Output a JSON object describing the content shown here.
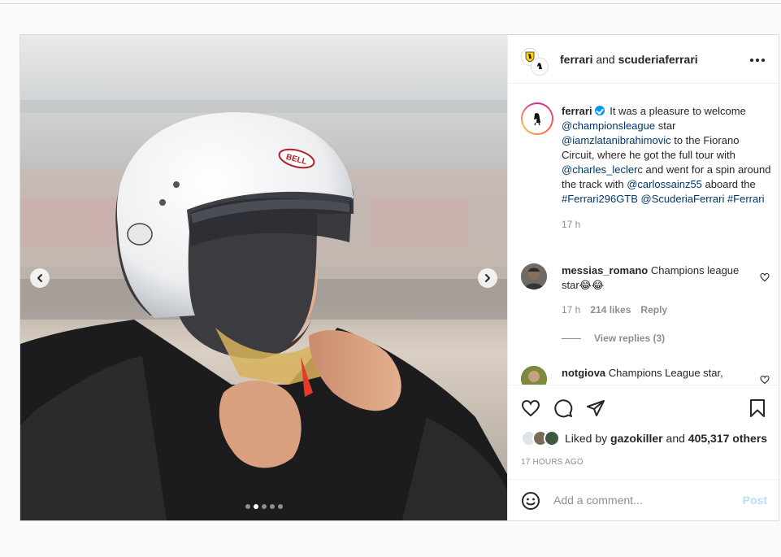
{
  "header": {
    "account1": "ferrari",
    "joiner": "and",
    "account2": "scuderiaferrari",
    "more_icon": "more-horizontal-icon"
  },
  "caption": {
    "username": "ferrari",
    "text_1": "It was a pleasure to welcome",
    "mention_1": "@championsleague",
    "text_2": "star",
    "mention_2": "@iamzlatanibrahimovic",
    "text_3": "to the Fiorano Circuit, where he got the full tour with",
    "mention_3": "@charles_leclerc",
    "text_4": "and went for a spin around the track with",
    "mention_4": "@carlossainz55",
    "text_5": "aboard the",
    "hashtag_1": "#Ferrari296GTB",
    "mention_5": "@ScuderiaFerrari",
    "hashtag_2": "#Ferrari",
    "age": "17 h"
  },
  "comments": [
    {
      "username": "messias_romano",
      "text": "Champions league star😂😂",
      "age": "17 h",
      "likes": "214 likes",
      "reply_label": "Reply",
      "view_replies": "View replies (3)"
    },
    {
      "username": "notgiova",
      "text": "Champions League star,"
    }
  ],
  "likes": {
    "prefix": "Liked by",
    "user": "gazokiller",
    "joiner": "and",
    "others": "405,317 others"
  },
  "timestamp": "17 HOURS AGO",
  "add_comment": {
    "placeholder": "Add a comment...",
    "post_label": "Post"
  },
  "carousel": {
    "slide_count": 5,
    "active_index": 1
  },
  "colors": {
    "accent": "#0095f6",
    "link": "#00376b",
    "post_disabled": "#b2dffc",
    "secondary_text": "#8e8e8e"
  }
}
